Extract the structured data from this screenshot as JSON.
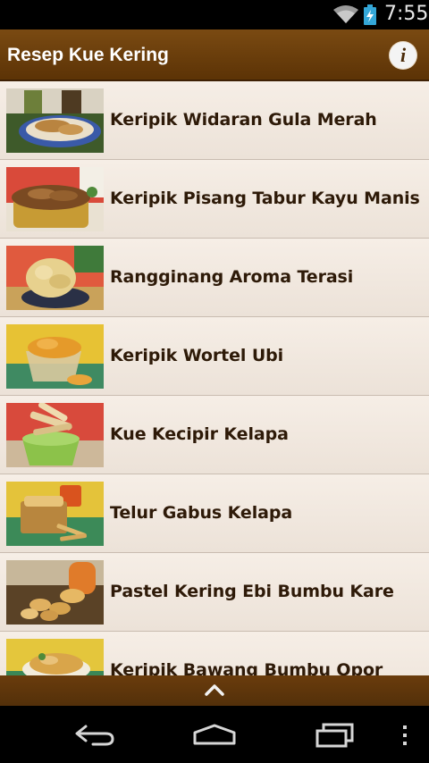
{
  "status_bar": {
    "time": "7:55",
    "icons": [
      "wifi-icon",
      "battery-charging-icon"
    ]
  },
  "app": {
    "title": "Resep Kue Kering",
    "info_icon": "info-icon",
    "brand_color": "#6b3d0c"
  },
  "recipes": [
    {
      "name": "Keripik Widaran Gula Merah",
      "image": "recipe-photo"
    },
    {
      "name": "Keripik Pisang Tabur Kayu Manis",
      "image": "recipe-photo"
    },
    {
      "name": "Rangginang Aroma Terasi",
      "image": "recipe-photo"
    },
    {
      "name": "Keripik Wortel Ubi",
      "image": "recipe-photo"
    },
    {
      "name": "Kue Kecipir Kelapa",
      "image": "recipe-photo"
    },
    {
      "name": "Telur Gabus Kelapa",
      "image": "recipe-photo"
    },
    {
      "name": "Pastel Kering Ebi Bumbu Kare",
      "image": "recipe-photo"
    },
    {
      "name": "Keripik Bawang Bumbu Opor",
      "image": "recipe-photo"
    }
  ],
  "bottom_bar": {
    "icon": "chevron-up-icon"
  },
  "navigation_bar": {
    "icons": [
      "back-icon",
      "home-icon",
      "recent-apps-icon",
      "overflow-menu-icon"
    ]
  }
}
